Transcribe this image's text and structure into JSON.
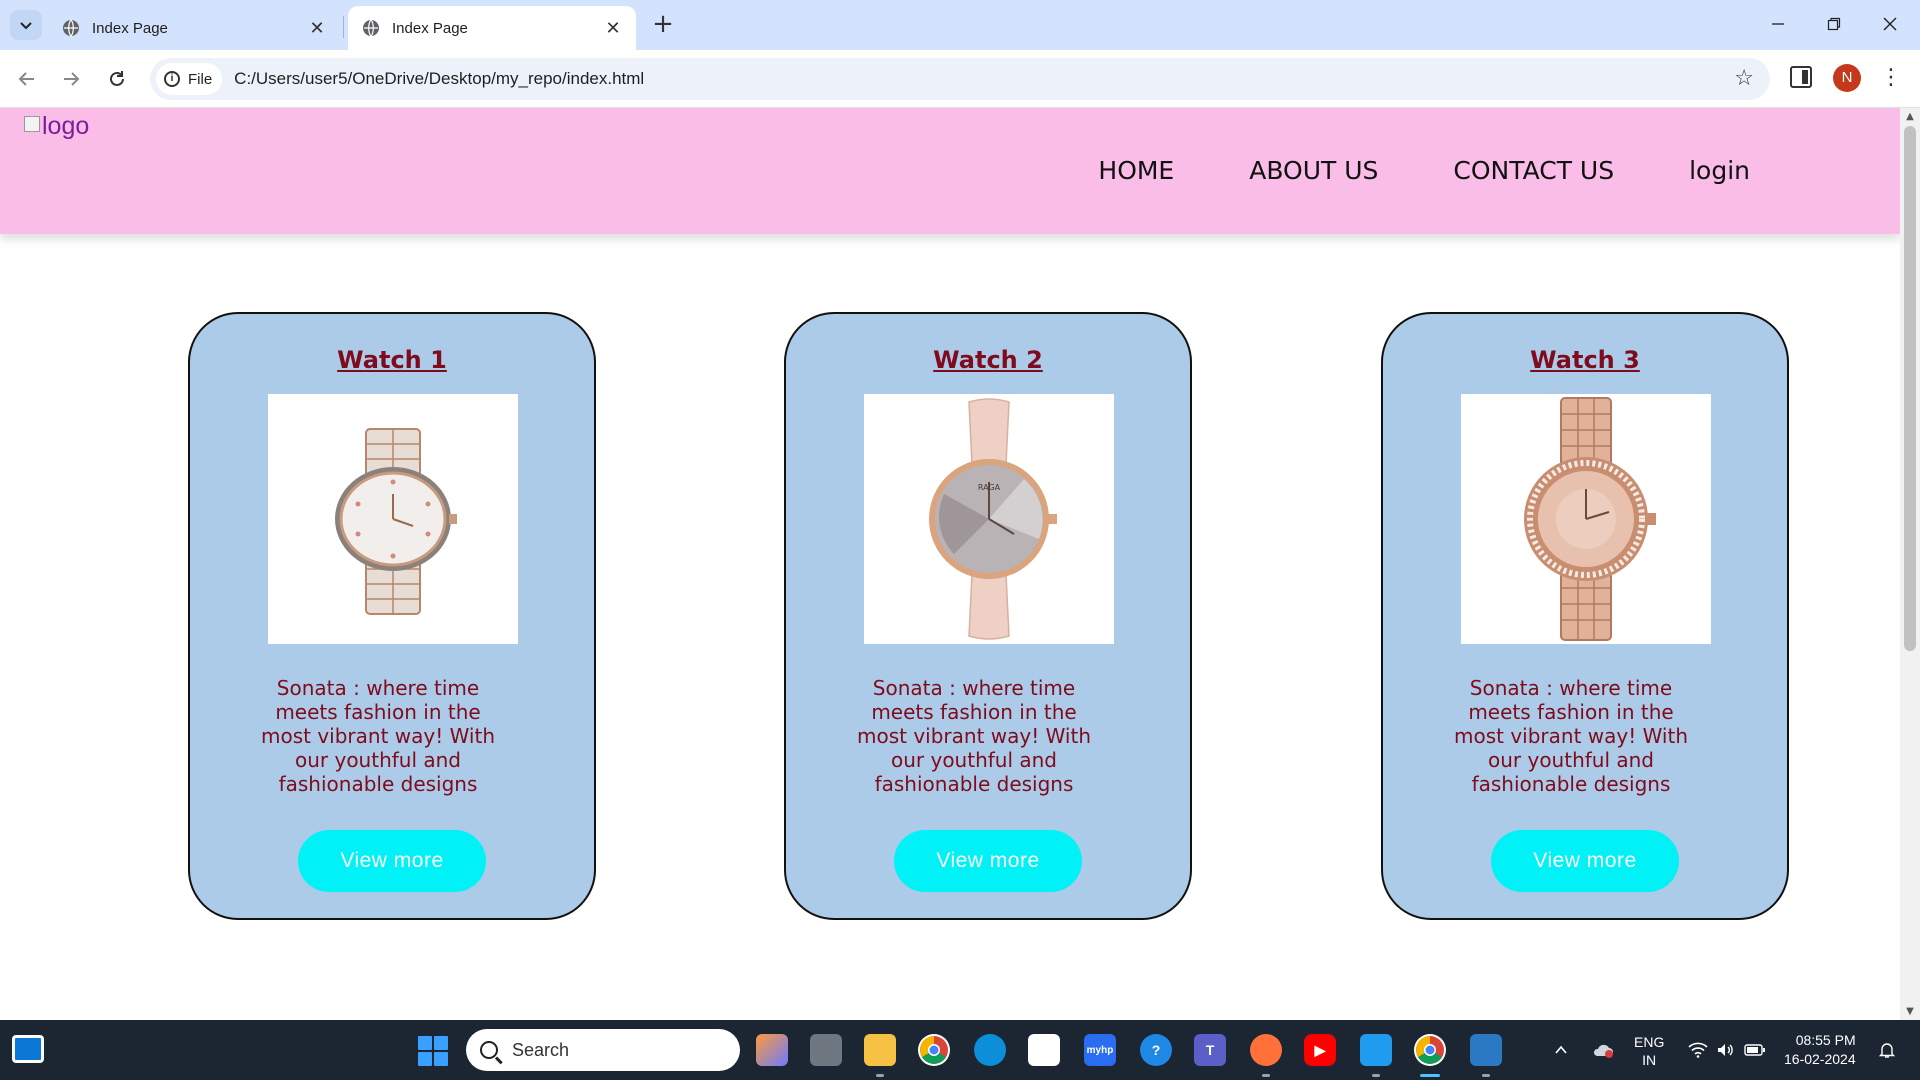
{
  "browser": {
    "tabs": [
      {
        "title": "Index Page",
        "active": false
      },
      {
        "title": "Index Page",
        "active": true
      }
    ],
    "file_chip": "File",
    "url": "C:/Users/user5/OneDrive/Desktop/my_repo/index.html",
    "profile_initial": "N"
  },
  "site": {
    "logo_alt": "logo",
    "nav": [
      "HOME",
      "ABOUT US",
      "CONTACT US",
      "login"
    ],
    "cards": [
      {
        "title": "Watch 1",
        "description": "Sonata : where time meets fashion in the most vibrant way! With our youthful and fashionable designs",
        "button": "View more"
      },
      {
        "title": "Watch 2",
        "description": "Sonata : where time meets fashion in the most vibrant way! With our youthful and fashionable designs",
        "button": "View more"
      },
      {
        "title": "Watch 3",
        "description": "Sonata : where time meets fashion in the most vibrant way! With our youthful and fashionable designs",
        "button": "View more"
      }
    ],
    "colors": {
      "header": "#f9bde8",
      "card": "#abcbe8",
      "button": "#00f2f6",
      "text_accent": "#7f0b1c"
    }
  },
  "taskbar": {
    "search_placeholder": "Search",
    "lang_line1": "ENG",
    "lang_line2": "IN",
    "time": "08:55 PM",
    "date": "16-02-2024"
  }
}
